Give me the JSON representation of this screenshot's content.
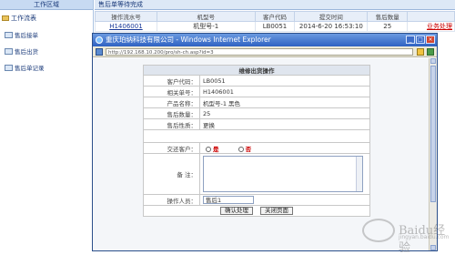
{
  "sidebar": {
    "title": "工作区域",
    "root": "工作流表",
    "items": [
      {
        "label": "售后接单"
      },
      {
        "label": "售后出货"
      },
      {
        "label": "售后单记录"
      }
    ]
  },
  "main": {
    "title": "售后单等待完成",
    "columns": [
      "操作流水号",
      "机型号",
      "客户代码",
      "提交时间",
      "售后数量",
      ""
    ],
    "row": {
      "serial": "H1406001",
      "model": "机型号-1",
      "customer": "LB0051",
      "time": "2014-6-20 16:53:10",
      "qty": "25",
      "action": "业务处理"
    }
  },
  "popup": {
    "title": "重庆珀纳科技有限公司 - Windows Internet Explorer",
    "url": "http://192.168.10.200/pro/sh-ch.asp?id=3",
    "form_title": "维修出货操作",
    "fields": {
      "customer_code_label": "客户代码：",
      "customer_code": "LB0051",
      "order_no_label": "相关单号：",
      "order_no": "H1406001",
      "product_label": "产品名称：",
      "product": "机型号-1 黑色",
      "qty_label": "售后数量：",
      "qty": "25",
      "aftersale_label": "售后性质：",
      "aftersale": "更换",
      "deliver_label": "交还客户：",
      "yes": "是",
      "no": "否",
      "remark_label": "备  注：",
      "operator_label": "操作人员：",
      "operator_value": "售后1"
    },
    "buttons": {
      "confirm": "确认处理",
      "close": "关闭页面"
    }
  },
  "watermark": {
    "brand": "Baidu经验",
    "sub": "jingyan.baidu.com"
  }
}
